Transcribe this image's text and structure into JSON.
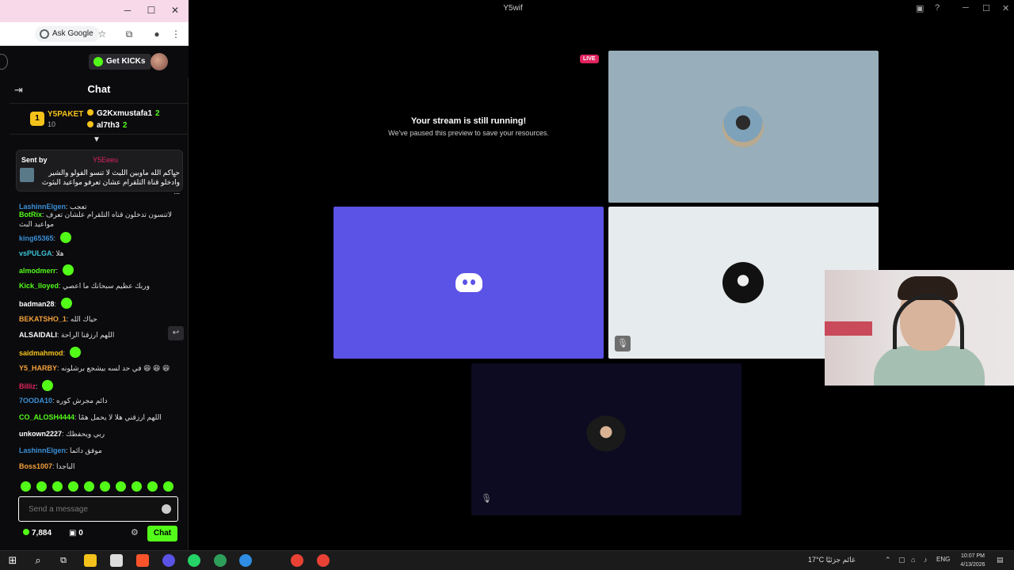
{
  "browser": {
    "toolbar": {
      "ask_google": "Ask Google"
    },
    "kick": {
      "get_kicks": "Get KICKs"
    }
  },
  "chat": {
    "title": "Chat",
    "leaderboard": {
      "rank": "1",
      "top_name": "Y5PAKET",
      "top_count": "10",
      "entries": [
        {
          "name": "G2Kxmustafa1",
          "count": "2"
        },
        {
          "name": "al7th3",
          "count": "2"
        }
      ]
    },
    "pinned": {
      "label": "Sent by",
      "sender": "Y5Eeeu",
      "text_line1": "حياكم الله ماوبين الليث لا تنسو الفولو والشير",
      "text_line2": "وادخلو قناة التلقرام عشان تعرفو مواعيد البثوث ..."
    },
    "messages": [
      {
        "user": "LashinnElgen",
        "text": "تعجب",
        "color": "#3a8fd6"
      },
      {
        "user": "BotRix",
        "text": "لاتنسون تدخلون قناه التلقرام علشان تعرف مواعيد البث",
        "link": "https://telegram.me/y5Espots",
        "color": "#53fc18"
      },
      {
        "user": "king65365",
        "text": "",
        "color": "#3a8fd6"
      },
      {
        "user": "vsPULGA",
        "text": "هلا",
        "color": "#3ac4d6"
      },
      {
        "user": "almodmerr",
        "text": "",
        "color": "#53fc18"
      },
      {
        "user": "Kick_lloyed",
        "text": "وربك عظيم سبحانك ما اعصي",
        "color": "#53fc18"
      },
      {
        "user": "badman28",
        "text": "",
        "color": "#ffffff"
      },
      {
        "user": "BEKATSHO_1",
        "text": "حياك الله",
        "color": "#f4a13b"
      },
      {
        "user": "ALSAIDALI",
        "text": "اللهم ارزقنا الراحة",
        "color": "#ffffff"
      },
      {
        "user": "saidmahmod",
        "text": "",
        "color": "#f4c21b"
      },
      {
        "user": "Y5_HARBY",
        "text": "في حد لسه بيشجع برشلونه 😆 😆 😆",
        "color": "#f4a13b"
      },
      {
        "user": "Billiz",
        "text": "",
        "color": "#e0245e"
      },
      {
        "user": "7OODA10",
        "text": "دائم مجرش كوره",
        "color": "#3a8fd6"
      },
      {
        "user": "CO_ALOSH4444",
        "text": "اللهم ارزقني هلا لا يحمل همًا",
        "color": "#53fc18"
      },
      {
        "user": "unkown2227",
        "text": "ربي ويحفظك",
        "color": "#ffffff"
      },
      {
        "user": "LashinnElgen",
        "text": "موفق دائما",
        "color": "#3a8fd6"
      },
      {
        "user": "Boss1007",
        "text": "الباجدا",
        "color": "#f4a13b"
      }
    ],
    "input_placeholder": "Send a message",
    "kicks_count": "7,884",
    "gifts_count": "0",
    "send_label": "Chat"
  },
  "app": {
    "title": "Y5wif",
    "live": "LIVE",
    "paused_title": "Your stream is still running!",
    "paused_sub": "We've paused this preview to save your resources."
  },
  "taskbar": {
    "weather": "17°C  غائم جزئيًا",
    "lang": "ENG",
    "time": "10:07 PM",
    "date": "4/13/2026"
  },
  "colors": {
    "kick_green": "#53fc18",
    "discord": "#5b52e6",
    "live_red": "#e0245e"
  }
}
